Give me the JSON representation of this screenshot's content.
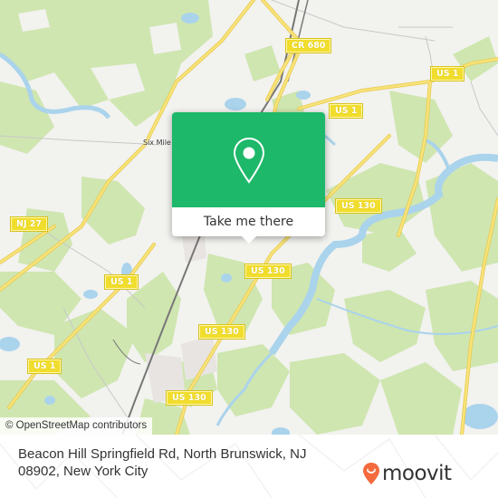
{
  "map": {
    "colors": {
      "land": "#f2f2ef",
      "forest": "#cfe6b0",
      "water": "#aad3ec",
      "road": "#f7e37a",
      "rail": "#777777",
      "popup_green": "#1db86a",
      "shield_yellow": "#f1dd2c",
      "brand_orange": "#f26a3d"
    },
    "road_shields": [
      {
        "label": "CR 680",
        "id": "cr-680"
      },
      {
        "label": "US 1",
        "id": "us-1-ne-right"
      },
      {
        "label": "US 1",
        "id": "us-1-ne-mid"
      },
      {
        "label": "NJ 27",
        "id": "nj-27"
      },
      {
        "label": "US 1",
        "id": "us-1-west"
      },
      {
        "label": "US 130",
        "id": "us-130-east"
      },
      {
        "label": "US 130",
        "id": "us-130-center"
      },
      {
        "label": "US 130",
        "id": "us-130-south"
      },
      {
        "label": "US 1",
        "id": "us-1-southwest"
      },
      {
        "label": "US 130",
        "id": "us-130-bottom"
      }
    ],
    "place_labels": [
      {
        "label": "Six Mile"
      }
    ],
    "attribution": "© OpenStreetMap contributors"
  },
  "popup": {
    "icon": "map-pin-icon",
    "button_label": "Take me there"
  },
  "footer": {
    "address": "Beacon Hill Springfield Rd, North Brunswick, NJ 08902, New York City",
    "logo_text": "moovit",
    "logo_icon": "moovit-pin-smile-icon"
  }
}
